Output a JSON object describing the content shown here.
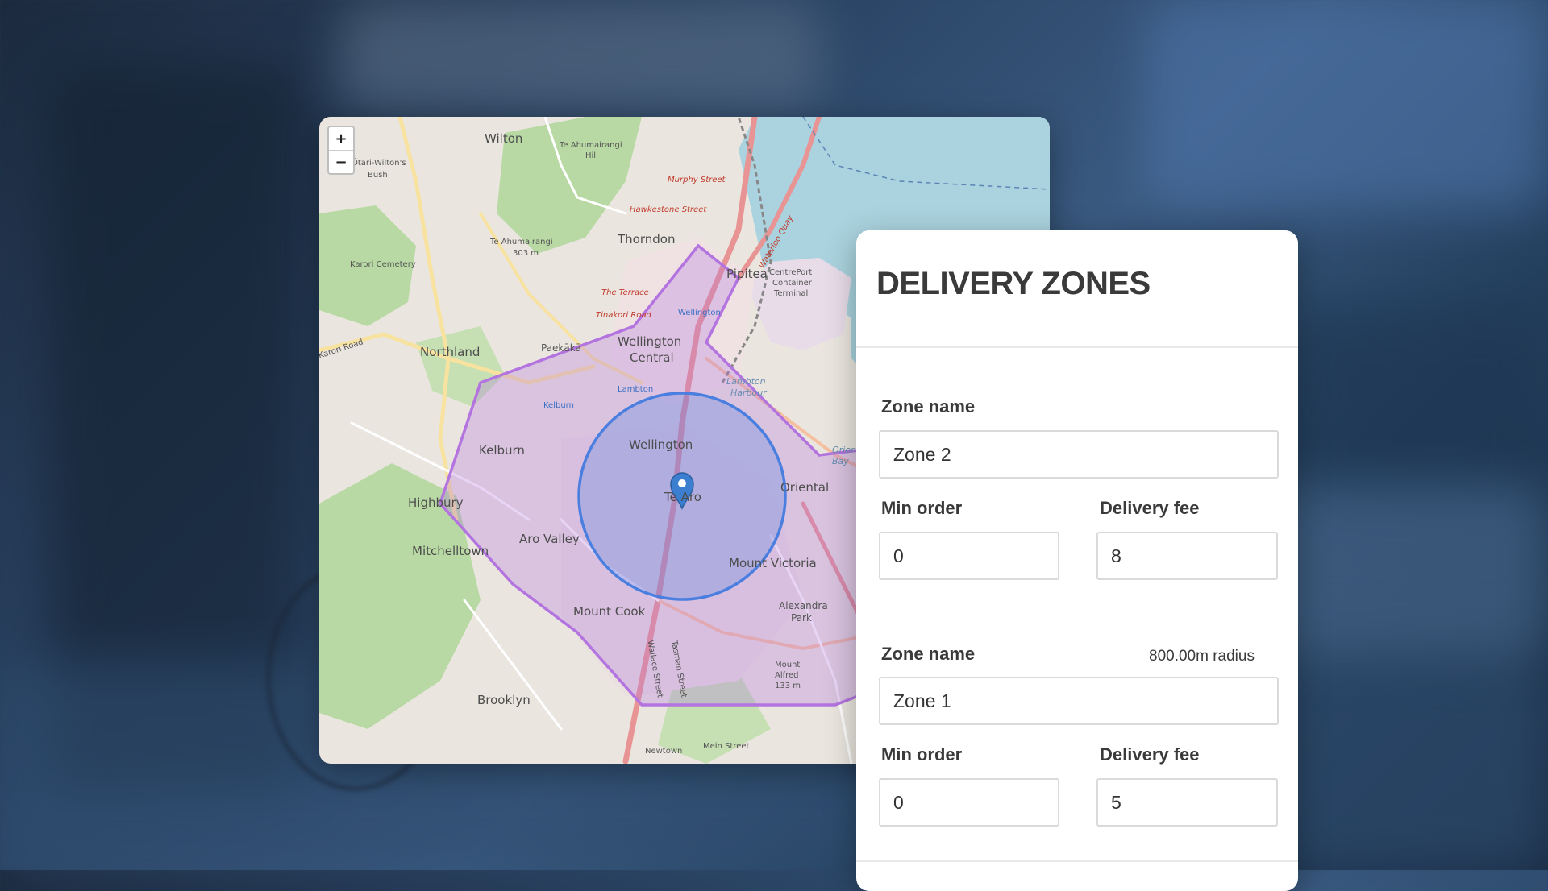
{
  "map": {
    "zoom_in": "+",
    "zoom_out": "−",
    "labels": {
      "wilton": "Wilton",
      "otari_1": "Ōtari-Wilton's",
      "otari_2": "Bush",
      "te_ahumairangi_hill_1": "Te Ahumairangi",
      "te_ahumairangi_hill_2": "Hill",
      "murphy_street": "Murphy Street",
      "hawkestone_street": "Hawkestone Street",
      "te_ahumairangi_peak_1": "Te Ahumairangi",
      "te_ahumairangi_peak_2": "303 m",
      "thorndon": "Thorndon",
      "karori_cemetery": "Karori Cemetery",
      "pipitea": "Pipitea",
      "centreport_1": "CentrePort",
      "centreport_2": "Container",
      "centreport_3": "Terminal",
      "the_terrace": "The Terrace",
      "tinakori_road": "Tinakori Road",
      "wellington_station": "Wellington",
      "northland": "Northland",
      "paekaka": "Paekākā",
      "wellington_central_1": "Wellington",
      "wellington_central_2": "Central",
      "kelburn_small": "Kelburn",
      "lambton": "Lambton",
      "lambton_harbour_1": "Lambton",
      "lambton_harbour_2": "Harbour",
      "kelburn": "Kelburn",
      "wellington": "Wellington",
      "te_aro": "Te Aro",
      "highbury": "Highbury",
      "oriental": "Oriental",
      "oriental_bay_1": "Oriental",
      "oriental_bay_2": "Bay",
      "mitchelltown": "Mitchelltown",
      "aro_valley": "Aro Valley",
      "mount_victoria": "Mount Victoria",
      "mount_cook": "Mount Cook",
      "alexandra_park_1": "Alexandra",
      "alexandra_park_2": "Park",
      "mount_alfred_1": "Mount",
      "mount_alfred_2": "Alfred",
      "mount_alfred_3": "133 m",
      "brooklyn": "Brooklyn",
      "newtown": "Newtown",
      "mein_street": "Mein Street",
      "waterloo_quay": "Waterloo Quay",
      "wallace_street": "Wallace Street",
      "tasman_street": "Tasman Street",
      "karori_road": "Karori Road"
    }
  },
  "panel": {
    "title": "DELIVERY ZONES",
    "zones": [
      {
        "zone_name_label": "Zone name",
        "zone_name_value": "Zone 2",
        "min_order_label": "Min order",
        "min_order_value": "0",
        "delivery_fee_label": "Delivery fee",
        "delivery_fee_value": "8"
      },
      {
        "zone_name_label": "Zone name",
        "radius_note": "800.00m radius",
        "zone_name_value": "Zone 1",
        "min_order_label": "Min order",
        "min_order_value": "0",
        "delivery_fee_label": "Delivery fee",
        "delivery_fee_value": "5"
      }
    ]
  },
  "colors": {
    "zone_polygon": "#b374e0",
    "zone_circle": "#4a7fe0",
    "water": "#aad3df",
    "map_land": "#eae6df",
    "park": "#b8d9a4"
  },
  "icons": {
    "marker": "map-pin-icon"
  }
}
